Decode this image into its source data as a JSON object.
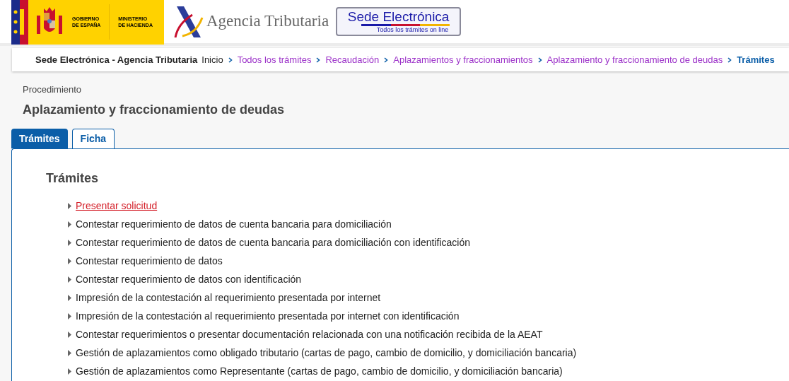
{
  "header": {
    "gov_lines": [
      "GOBIERNO",
      "DE ESPAÑA"
    ],
    "ministry_lines": [
      "MINISTERIO",
      "DE HACIENDA"
    ],
    "agency": "Agencia Tributaria",
    "sede_title": "Sede Electrónica",
    "sede_subtitle": "Todos los trámites on line"
  },
  "breadcrumb": {
    "site": "Sede Electrónica - Agencia Tributaria",
    "items": [
      {
        "label": "Inicio",
        "kind": "plain"
      },
      {
        "label": "Todos los trámites",
        "kind": "link"
      },
      {
        "label": "Recaudación",
        "kind": "link"
      },
      {
        "label": "Aplazamientos y fraccionamientos",
        "kind": "link"
      },
      {
        "label": "Aplazamiento y fraccionamiento de deudas",
        "kind": "link"
      },
      {
        "label": "Trámites",
        "kind": "current"
      }
    ]
  },
  "procedure": {
    "label": "Procedimiento",
    "title": "Aplazamiento y fraccionamiento de deudas"
  },
  "tabs": [
    {
      "label": "Trámites",
      "selected": true
    },
    {
      "label": "Ficha",
      "selected": false
    }
  ],
  "section_title": "Trámites",
  "items": [
    {
      "label": "Presentar solicitud",
      "highlighted": true
    },
    {
      "label": "Contestar requerimiento de datos de cuenta bancaria para domiciliación",
      "highlighted": false
    },
    {
      "label": "Contestar requerimiento de datos de cuenta bancaria para domiciliación con identificación",
      "highlighted": false
    },
    {
      "label": "Contestar requerimiento de datos",
      "highlighted": false
    },
    {
      "label": "Contestar requerimiento de datos con identificación",
      "highlighted": false
    },
    {
      "label": "Impresión de la contestación al requerimiento presentada por internet",
      "highlighted": false
    },
    {
      "label": "Impresión de la contestación al requerimiento presentada por internet con identificación",
      "highlighted": false
    },
    {
      "label": "Contestar requerimientos o presentar documentación relacionada con una notificación recibida de la AEAT",
      "highlighted": false
    },
    {
      "label": "Gestión de aplazamientos como obligado tributario (cartas de pago, cambio de domicilio, y domiciliación bancaria)",
      "highlighted": false
    },
    {
      "label": "Gestión de aplazamientos como Representante (cartas de pago, cambio de domicilio, y domiciliación bancaria)",
      "highlighted": false
    }
  ]
}
